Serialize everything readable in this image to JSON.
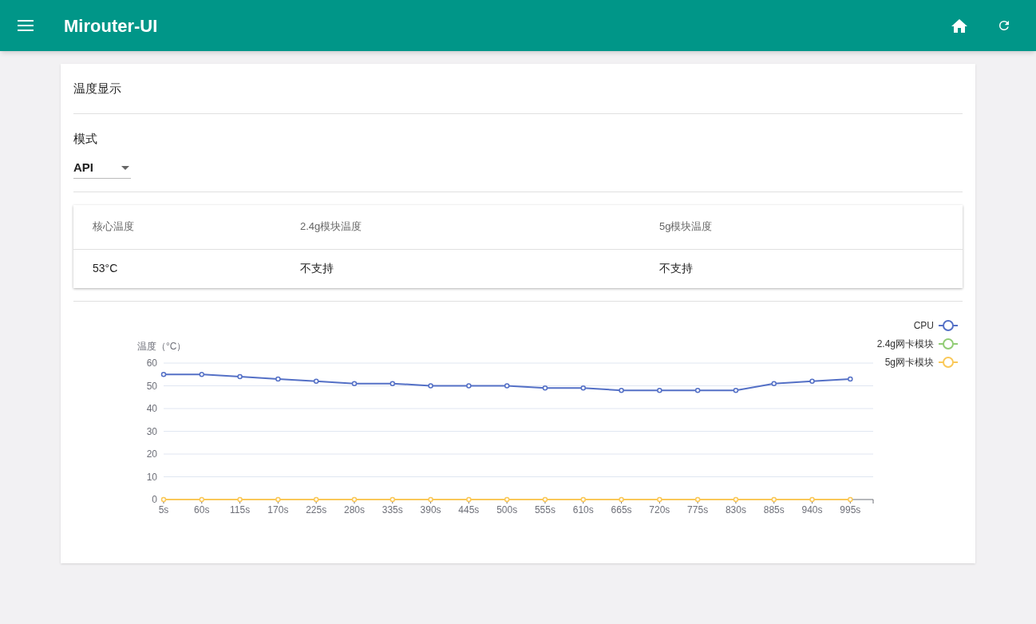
{
  "app_bar": {
    "title": "Mirouter-UI"
  },
  "card": {
    "title": "温度显示",
    "mode": {
      "label": "模式",
      "value": "API"
    },
    "table": {
      "columns": [
        "核心温度",
        "2.4g模块温度",
        "5g模块温度"
      ],
      "rows": [
        [
          "53°C",
          "不支持",
          "不支持"
        ]
      ]
    },
    "chart_data": {
      "type": "line",
      "grid": true,
      "legend": true,
      "ylabel": "温度（°C）",
      "x": [
        5,
        60,
        115,
        170,
        225,
        280,
        335,
        390,
        445,
        500,
        555,
        610,
        665,
        720,
        775,
        830,
        885,
        940,
        995
      ],
      "xlim": [
        5,
        1028
      ],
      "ylim": [
        0,
        60
      ],
      "yticks": [
        0,
        10,
        20,
        30,
        40,
        50,
        60
      ],
      "xticks": [
        {
          "value": 5,
          "label": "5s"
        },
        {
          "value": 60,
          "label": "60s"
        },
        {
          "value": 115,
          "label": "115s"
        },
        {
          "value": 170,
          "label": "170s"
        },
        {
          "value": 225,
          "label": "225s"
        },
        {
          "value": 280,
          "label": "280s"
        },
        {
          "value": 335,
          "label": "335s"
        },
        {
          "value": 390,
          "label": "390s"
        },
        {
          "value": 445,
          "label": "445s"
        },
        {
          "value": 500,
          "label": "500s"
        },
        {
          "value": 555,
          "label": "555s"
        },
        {
          "value": 610,
          "label": "610s"
        },
        {
          "value": 665,
          "label": "665s"
        },
        {
          "value": 720,
          "label": "720s"
        },
        {
          "value": 775,
          "label": "775s"
        },
        {
          "value": 830,
          "label": "830s"
        },
        {
          "value": 885,
          "label": "885s"
        },
        {
          "value": 940,
          "label": "940s"
        },
        {
          "value": 995,
          "label": "995s"
        }
      ],
      "series": [
        {
          "name": "CPU",
          "color": "#5470c6",
          "marker": "circle",
          "values": [
            55,
            55,
            54,
            53,
            52,
            51,
            51,
            50,
            50,
            50,
            49,
            49,
            48,
            48,
            48,
            48,
            51,
            52,
            53
          ]
        },
        {
          "name": "2.4g网卡模块",
          "color": "#91cc75",
          "marker": "circle",
          "values": [
            null,
            null,
            null,
            null,
            null,
            null,
            null,
            null,
            null,
            null,
            null,
            null,
            null,
            null,
            null,
            null,
            null,
            null,
            null
          ]
        },
        {
          "name": "5g网卡模块",
          "color": "#fac858",
          "marker": "circle",
          "values": [
            0,
            0,
            0,
            0,
            0,
            0,
            0,
            0,
            0,
            0,
            0,
            0,
            0,
            0,
            0,
            0,
            0,
            0,
            0
          ]
        }
      ]
    }
  }
}
